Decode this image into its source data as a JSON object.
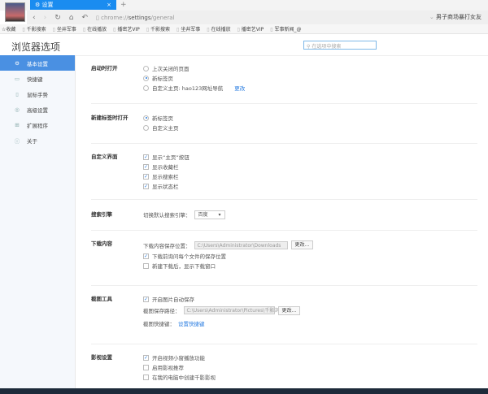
{
  "tab": {
    "label": "设置",
    "close": "×",
    "new": "+"
  },
  "nav": {
    "back": "‹",
    "forward": "›",
    "reload": "↻",
    "home": "⌂",
    "undo": "↶",
    "url_prefix": "chrome://",
    "url_main": "settings",
    "url_suffix": "/general",
    "news": "男子商场暴打女友"
  },
  "bookmarks": {
    "star": "☆收藏",
    "items": [
      "千影搜索",
      "坐井军事",
      "在线播放",
      "播密艺VIP",
      "千影搜索",
      "坐井军事",
      "在线播放",
      "播密艺VIP",
      "军事新闻_@"
    ]
  },
  "header": {
    "title": "浏览器选项",
    "search_placeholder": "在选项中搜索"
  },
  "sidebar": {
    "items": [
      {
        "label": "基本设置",
        "icon": "⚙"
      },
      {
        "label": "快捷键",
        "icon": "▭"
      },
      {
        "label": "鼠标手势",
        "icon": "▯"
      },
      {
        "label": "高级设置",
        "icon": "◎"
      },
      {
        "label": "扩展程序",
        "icon": "⊞"
      },
      {
        "label": "关于",
        "icon": "ⓘ"
      }
    ]
  },
  "startup": {
    "label": "启动时打开",
    "options": [
      "上次关闭的页面",
      "新标签页",
      "自定义主页: hao123网址导航"
    ],
    "change": "更改"
  },
  "newtab": {
    "label": "新建标签时打开",
    "options": [
      "新标签页",
      "自定义主页"
    ]
  },
  "ui": {
    "label": "自定义界面",
    "options": [
      "显示“主页”按钮",
      "显示收藏栏",
      "显示搜索栏",
      "显示状态栏"
    ]
  },
  "search": {
    "label": "搜索引擎",
    "prompt": "切换默认搜索引擎：",
    "value": "百度"
  },
  "download": {
    "label": "下载内容",
    "path_label": "下载内容保存位置：",
    "path": "C:\\Users\\Administrator\\Downloads",
    "change": "更改...",
    "options": [
      "下载前询问每个文件的保存位置",
      "新建下载后，显示下载窗口"
    ]
  },
  "screenshot": {
    "label": "截图工具",
    "option": "开启图片自动保存",
    "path_label": "截图保存路径：",
    "path": "C:\\Users\\Administrator\\Pictures\\千影浏",
    "change": "更改...",
    "shortcut_label": "截图快捷键：",
    "shortcut_link": "设置快捷键"
  },
  "video": {
    "label": "影视设置",
    "options": [
      "开启视频小窗播放功能",
      "启用影视推荐",
      "在我的电脑中创建千影影视"
    ]
  }
}
